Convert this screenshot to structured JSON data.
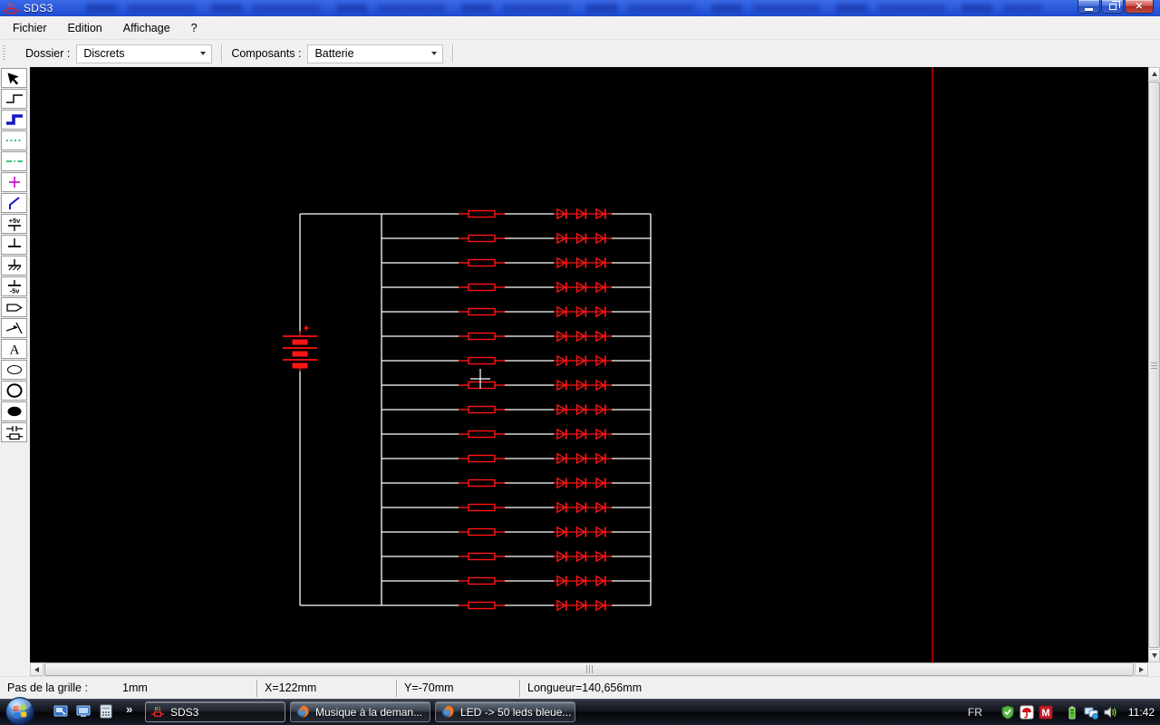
{
  "window": {
    "title": "SDS3"
  },
  "menu": {
    "items": [
      "Fichier",
      "Edition",
      "Affichage",
      "?"
    ]
  },
  "toolbar": {
    "dossier_label": "Dossier :",
    "dossier_value": "Discrets",
    "composants_label": "Composants :",
    "composants_value": "Batterie"
  },
  "tools": [
    {
      "name": "tool-select",
      "icon": "cursor-icon"
    },
    {
      "name": "tool-wire-thin",
      "icon": "wire-step-icon"
    },
    {
      "name": "tool-wire-thick",
      "icon": "wire-step-thick-icon",
      "selected": true
    },
    {
      "name": "tool-dotted-line",
      "icon": "dotted-line-icon"
    },
    {
      "name": "tool-dashdot-line",
      "icon": "dashdot-line-icon"
    },
    {
      "name": "tool-junction-cross",
      "icon": "cross-icon"
    },
    {
      "name": "tool-diagonal-wire",
      "icon": "diagonal-line-icon"
    },
    {
      "name": "tool-power-plus5v",
      "icon": "plus5v-icon",
      "label": "+5v"
    },
    {
      "name": "tool-ground",
      "icon": "ground-icon"
    },
    {
      "name": "tool-earth-ground",
      "icon": "earth-ground-icon"
    },
    {
      "name": "tool-power-minus5v",
      "icon": "minus5v-icon",
      "label": "-5v"
    },
    {
      "name": "tool-net-label",
      "icon": "net-label-icon"
    },
    {
      "name": "tool-port-arrow",
      "icon": "port-arrow-icon"
    },
    {
      "name": "tool-text",
      "icon": "text-icon",
      "label": "A"
    },
    {
      "name": "tool-ellipse",
      "icon": "ellipse-icon"
    },
    {
      "name": "tool-circle",
      "icon": "circle-icon"
    },
    {
      "name": "tool-ellipse-filled",
      "icon": "ellipse-filled-icon"
    },
    {
      "name": "tool-component",
      "icon": "component-icon"
    }
  ],
  "schematic": {
    "description": "Battery feeding 17 parallel branches, each branch = 1 resistor + 3 LEDs in series",
    "branch_count": 17,
    "leds_per_branch": 3,
    "resistors_per_branch": 1,
    "battery_polarity_label": "+",
    "wire_color": "#ffffff",
    "component_color": "#ff1414",
    "page_boundary_color": "#c00000",
    "background_color": "#000000"
  },
  "statusbar": {
    "grid_label": "Pas de la grille :",
    "grid_value": "1mm",
    "x_value": "X=122mm",
    "y_value": "Y=-70mm",
    "length_value": "Longueur=140,656mm"
  },
  "taskbar": {
    "overflow_chevron": "»",
    "quick_launch": [
      {
        "name": "switch-windows-icon"
      },
      {
        "name": "show-desktop-icon"
      },
      {
        "name": "calculator-icon"
      }
    ],
    "windows": [
      {
        "name": "taskbar-button-sds3",
        "label": "SDS3",
        "icon": "sds3",
        "active": true
      },
      {
        "name": "taskbar-button-musique",
        "label": "Musique à la deman...",
        "icon": "firefox",
        "active": false
      },
      {
        "name": "taskbar-button-led",
        "label": "LED -> 50 leds bleue...",
        "icon": "firefox",
        "active": false
      }
    ],
    "tray": {
      "language": "FR",
      "time": "11:42",
      "icons": [
        "security-shield-icon",
        "avira-antivirus-icon",
        "m-app-icon",
        "battery-icon",
        "network-icon",
        "volume-icon"
      ]
    }
  }
}
